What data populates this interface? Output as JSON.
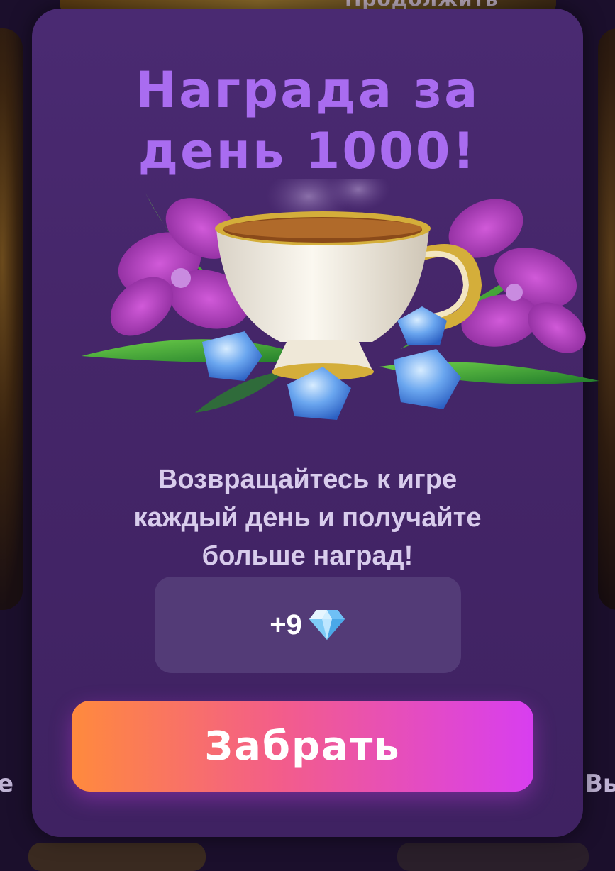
{
  "background": {
    "top_button_label": "Продолжить",
    "left_edge_text": "е",
    "right_edge_text": "Вы"
  },
  "modal": {
    "title_line1": "Награда за",
    "title_line2": "день 1000!",
    "illustration_icon": "teacup-flowers-gems-icon",
    "description_line1": "Возвращайтесь к игре",
    "description_line2": "каждый день и получайте",
    "description_line3": "больше наград!",
    "reward": {
      "amount": "+9",
      "icon": "diamond-icon"
    },
    "claim_button_label": "Забрать"
  },
  "colors": {
    "modal_bg": "#452669",
    "title": "#a96cf0",
    "description": "#d8ccec",
    "reward_box": "#533b77",
    "button_gradient_start": "#ff8a3d",
    "button_gradient_end": "#d83ef0"
  }
}
